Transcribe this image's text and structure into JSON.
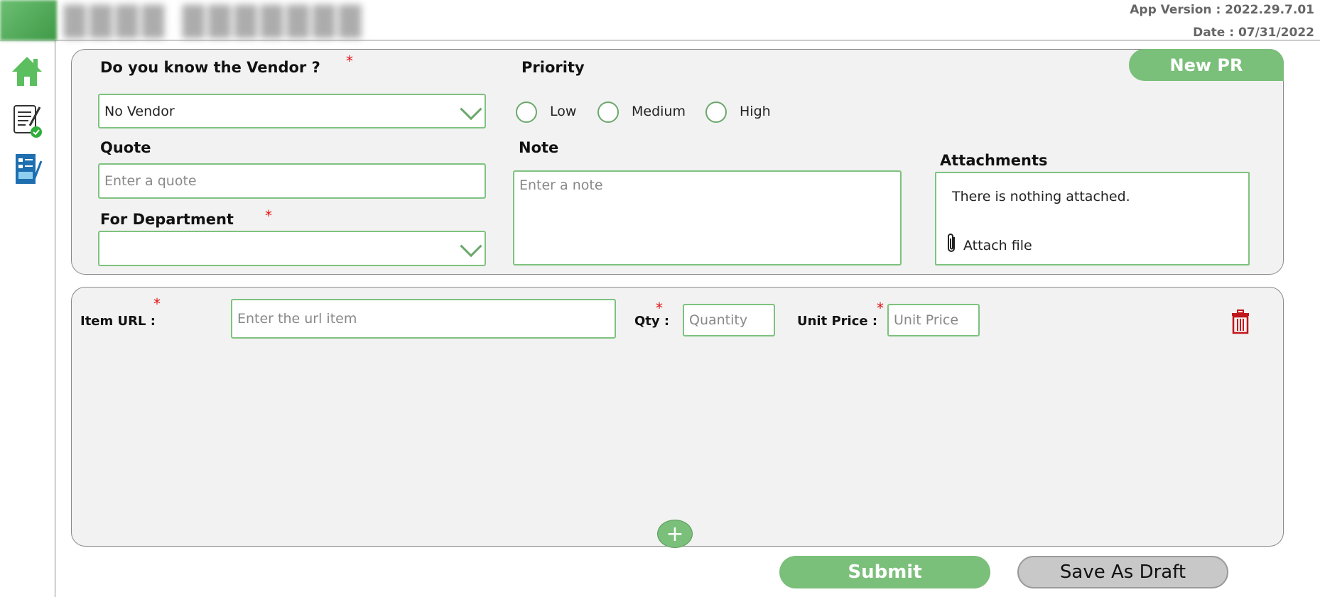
{
  "header": {
    "app_version": "App Version : 2022.29.7.01",
    "date": "Date : 07/31/2022"
  },
  "sidebar": {
    "items": [
      {
        "icon": "home-icon"
      },
      {
        "icon": "approval-document-icon"
      },
      {
        "icon": "request-form-icon"
      }
    ]
  },
  "form": {
    "badge": "New PR",
    "vendor_label": "Do you know the Vendor ?",
    "vendor_value": "No Vendor",
    "priority_label": "Priority",
    "priority_options": [
      "Low",
      "Medium",
      "High"
    ],
    "quote_label": "Quote",
    "quote_placeholder": "Enter a quote",
    "note_label": "Note",
    "note_placeholder": "Enter a note",
    "department_label": "For Department",
    "department_value": "",
    "attachments_label": "Attachments",
    "attachments_empty": "There is nothing attached.",
    "attach_file": "Attach file",
    "required_mark": "*"
  },
  "items": {
    "url_label": "Item URL :",
    "url_placeholder": "Enter the url item",
    "qty_label": "Qty :",
    "qty_placeholder": "Quantity",
    "price_label": "Unit Price :",
    "price_placeholder": "Unit Price",
    "add_symbol": "+"
  },
  "actions": {
    "submit": "Submit",
    "save_draft": "Save As Draft"
  },
  "colors": {
    "accent": "#7abf7a",
    "required": "#e01010",
    "trash": "#c0161c"
  }
}
